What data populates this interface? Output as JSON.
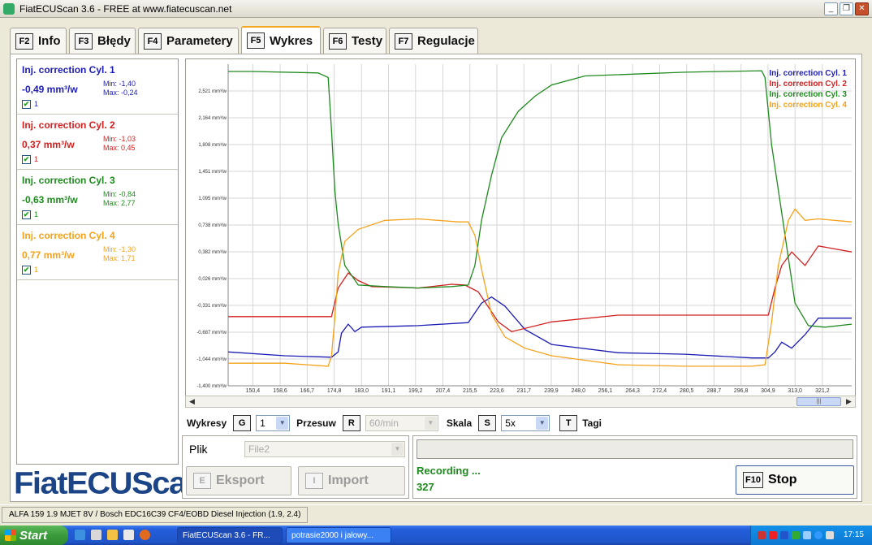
{
  "window": {
    "title": "FiatECUScan 3.6 - FREE at www.fiatecuscan.net"
  },
  "tabs": [
    {
      "key": "F2",
      "label": "Info"
    },
    {
      "key": "F3",
      "label": "Błędy"
    },
    {
      "key": "F4",
      "label": "Parametery"
    },
    {
      "key": "F5",
      "label": "Wykres"
    },
    {
      "key": "F6",
      "label": "Testy"
    },
    {
      "key": "F7",
      "label": "Regulacje"
    }
  ],
  "active_tab": "Wykres",
  "parameters": [
    {
      "name": "Inj. correction Cyl. 1",
      "value": "-0,49 mm³/w",
      "min": "Min: -1,40",
      "max": "Max: -0,24",
      "checkbox_label": "1",
      "checked": true,
      "color": "#1c1cb4"
    },
    {
      "name": "Inj. correction Cyl. 2",
      "value": "0,37 mm³/w",
      "min": "Min: -1,03",
      "max": "Max: 0,45",
      "checkbox_label": "1",
      "checked": true,
      "color": "#d22020"
    },
    {
      "name": "Inj. correction Cyl. 3",
      "value": "-0,63 mm³/w",
      "min": "Min: -0,84",
      "max": "Max: 2,77",
      "checkbox_label": "1",
      "checked": true,
      "color": "#1e8a1e"
    },
    {
      "name": "Inj. correction Cyl. 4",
      "value": "0,77 mm³/w",
      "min": "Min: -1,30",
      "max": "Max: 1,71",
      "checkbox_label": "1",
      "checked": true,
      "color": "#f5a21a"
    }
  ],
  "logo": "FiatECUScan",
  "chart_data": {
    "type": "line",
    "y_ticks": [
      "2,521 mm³/w",
      "2,164 mm³/w",
      "1,808 mm³/w",
      "1,451 mm³/w",
      "1,095 mm³/w",
      "0,738 mm³/w",
      "0,382 mm³/w",
      "0,026 mm³/w",
      "-0,331 mm³/w",
      "-0,687 mm³/w",
      "-1,044 mm³/w",
      "-1,400 mm³/w"
    ],
    "x_ticks": [
      "150,4",
      "158,6",
      "166,7",
      "174,8",
      "183,0",
      "191,1",
      "199,2",
      "207,4",
      "215,5",
      "223,6",
      "231,7",
      "239,9",
      "248,0",
      "256,1",
      "264,3",
      "272,4",
      "280,5",
      "288,7",
      "296,8",
      "304,9",
      "313,0",
      "321,2"
    ],
    "ylim": [
      -1.4,
      2.877
    ],
    "xlim": [
      143.0,
      330.0
    ],
    "grid": true,
    "legend_position": "top-right",
    "series": [
      {
        "name": "Inj. correction Cyl. 1",
        "color": "#1c1cb4",
        "x": [
          143,
          160,
          174,
          176,
          177,
          179,
          181,
          183,
          200,
          215,
          219,
          222,
          226,
          232,
          240,
          260,
          280,
          300,
          305,
          307,
          309,
          312,
          316,
          320,
          330
        ],
        "y": [
          -0.95,
          -1.0,
          -1.02,
          -0.95,
          -0.7,
          -0.58,
          -0.68,
          -0.62,
          -0.6,
          -0.56,
          -0.3,
          -0.22,
          -0.34,
          -0.65,
          -0.85,
          -0.96,
          -0.98,
          -1.03,
          -1.03,
          -0.95,
          -0.82,
          -0.9,
          -0.72,
          -0.5,
          -0.5
        ]
      },
      {
        "name": "Inj. correction Cyl. 2",
        "color": "#d22020",
        "x": [
          143,
          160,
          174,
          176,
          179,
          182,
          186,
          200,
          210,
          214,
          218,
          224,
          228,
          240,
          260,
          280,
          300,
          305,
          307,
          309,
          312,
          316,
          320,
          330
        ],
        "y": [
          -0.48,
          -0.48,
          -0.48,
          -0.1,
          0.1,
          0.0,
          -0.08,
          -0.1,
          -0.05,
          -0.06,
          -0.15,
          -0.55,
          -0.68,
          -0.55,
          -0.46,
          -0.46,
          -0.46,
          -0.46,
          -0.1,
          0.2,
          0.38,
          0.2,
          0.46,
          0.38
        ]
      },
      {
        "name": "Inj. correction Cyl. 3",
        "color": "#1e8a1e",
        "x": [
          143,
          150,
          170,
          173,
          174,
          175,
          176,
          178,
          182,
          190,
          200,
          210,
          215,
          217,
          219,
          222,
          225,
          230,
          235,
          240,
          250,
          280,
          303,
          304,
          306,
          309,
          313,
          317,
          322,
          330
        ],
        "y": [
          2.78,
          2.78,
          2.76,
          2.7,
          2.0,
          1.2,
          0.75,
          0.2,
          -0.06,
          -0.08,
          -0.1,
          -0.08,
          -0.06,
          0.2,
          0.8,
          1.4,
          1.9,
          2.25,
          2.45,
          2.6,
          2.72,
          2.77,
          2.79,
          2.7,
          1.8,
          0.9,
          -0.3,
          -0.6,
          -0.62,
          -0.58
        ]
      },
      {
        "name": "Inj. correction Cyl. 4",
        "color": "#f5a21a",
        "x": [
          143,
          160,
          173,
          174,
          175,
          176,
          178,
          182,
          190,
          200,
          212,
          215,
          217,
          219,
          222,
          226,
          232,
          240,
          260,
          280,
          300,
          304,
          306,
          308,
          311,
          313,
          316,
          320,
          330
        ],
        "y": [
          -1.1,
          -1.1,
          -1.14,
          -1.0,
          -0.5,
          0.1,
          0.52,
          0.68,
          0.8,
          0.82,
          0.78,
          0.78,
          0.6,
          0.15,
          -0.45,
          -0.75,
          -0.9,
          -1.0,
          -1.12,
          -1.14,
          -1.14,
          -1.12,
          -0.55,
          0.2,
          0.8,
          0.95,
          0.8,
          0.82,
          0.78
        ]
      }
    ]
  },
  "controls": {
    "wykresy_label": "Wykresy",
    "wykresy_key": "G",
    "wykresy_value": "1",
    "przesuw_label": "Przesuw",
    "przesuw_key": "R",
    "przesuw_value": "60/min",
    "skala_label": "Skala",
    "skala_key": "S",
    "skala_value": "5x",
    "tagi_key": "T",
    "tagi_label": "Tagi"
  },
  "file": {
    "plik_label": "Plik",
    "plik_value": "File2",
    "eksport_key": "E",
    "eksport_label": "Eksport",
    "import_key": "I",
    "import_label": "Import"
  },
  "status": {
    "recording": "Recording ...",
    "count": "327",
    "stop_key": "F10",
    "stop_label": "Stop"
  },
  "statusbar_text": "ALFA 159 1.9 MJET 8V / Bosch EDC16C39 CF4/EOBD Diesel Injection (1.9, 2.4)",
  "taskbar": {
    "start": "Start",
    "items": [
      "FiatECUScan 3.6 - FR...",
      "potrasie2000 i jałowy..."
    ],
    "clock": "17:15"
  }
}
